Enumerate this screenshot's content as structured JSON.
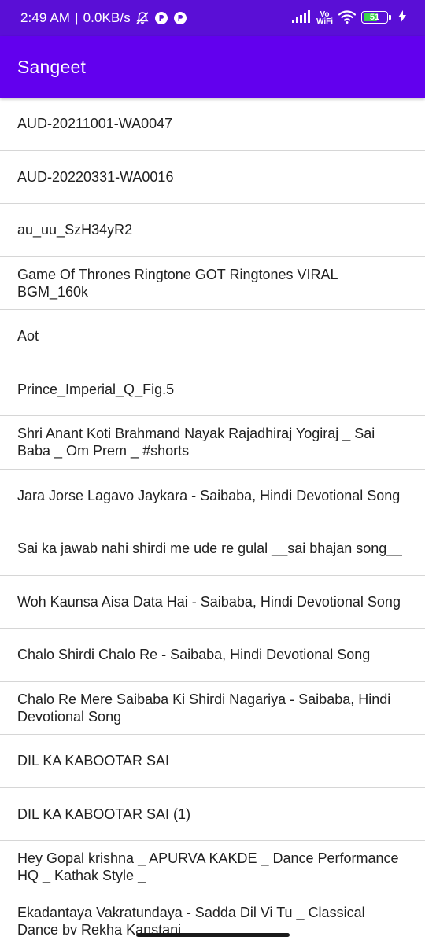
{
  "status_bar": {
    "time": "2:49 AM",
    "separator": "|",
    "net_speed": "0.0KB/s",
    "vo": "Vo",
    "wifi_label": "WiFi",
    "battery": "51",
    "icons": [
      "mute-alarm-icon",
      "app-notification-icon",
      "app-notification-icon",
      "signal-icon",
      "wifi-icon",
      "battery-icon",
      "charging-icon"
    ]
  },
  "app_bar": {
    "title": "Sangeet",
    "color": "#6200ee"
  },
  "songs": [
    "AUD-20211001-WA0047",
    "AUD-20220331-WA0016",
    "au_uu_SzH34yR2",
    "Game Of Thrones Ringtone GOT Ringtones VIRAL BGM_160k",
    "Aot",
    "Prince_Imperial_Q_Fig.5",
    "Shri Anant Koti Brahmand Nayak Rajadhiraj Yogiraj _ Sai Baba _ Om Prem _ #shorts",
    "Jara Jorse Lagavo Jaykara - Saibaba, Hindi Devotional Song",
    "Sai ka jawab nahi shirdi me ude re gulal __sai bhajan song__",
    "Woh Kaunsa Aisa Data Hai - Saibaba, Hindi Devotional Song",
    "Chalo Shirdi Chalo Re - Saibaba, Hindi Devotional Song",
    "Chalo Re Mere Saibaba Ki Shirdi Nagariya - Saibaba, Hindi Devotional Song",
    "DIL KA KABOOTAR SAI",
    "DIL KA KABOOTAR SAI (1)",
    "Hey Gopal krishna _ APURVA KAKDE _ Dance Performance HQ _ Kathak Style _",
    "Ekadantaya Vakratundaya - Sadda Dil Vi Tu _ Classical Dance by Rekha Kanstani"
  ]
}
